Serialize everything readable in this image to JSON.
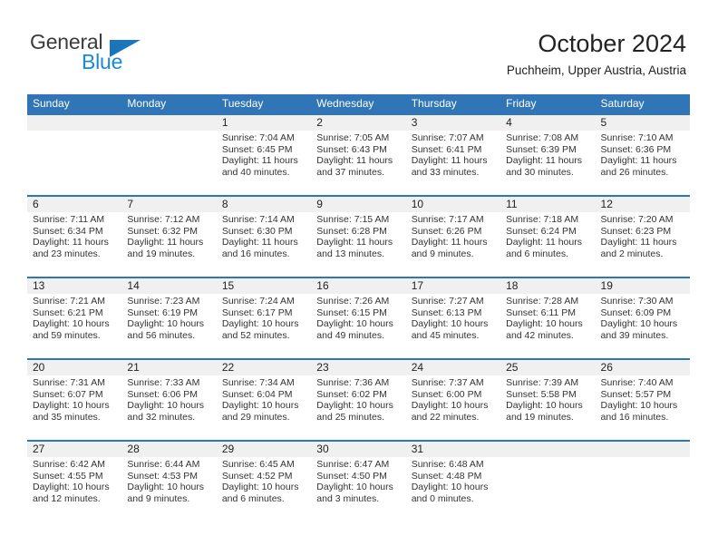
{
  "brand": {
    "name_part1": "General",
    "name_part2": "Blue",
    "triangle_color": "#1b75bb",
    "blue_color": "#1b8ad6"
  },
  "header": {
    "title": "October 2024",
    "subtitle": "Puchheim, Upper Austria, Austria"
  },
  "theme": {
    "header_blue": "#3075b5",
    "daynum_band": "#f0f0f0",
    "text": "#222222"
  },
  "labels": {
    "sunrise_prefix": "Sunrise: ",
    "sunset_prefix": "Sunset: ",
    "daylight_prefix": "Daylight: "
  },
  "weekdays": [
    "Sunday",
    "Monday",
    "Tuesday",
    "Wednesday",
    "Thursday",
    "Friday",
    "Saturday"
  ],
  "weeks": [
    [
      {
        "day": "",
        "sunrise": "",
        "sunset": "",
        "daylight": "",
        "empty": true
      },
      {
        "day": "",
        "sunrise": "",
        "sunset": "",
        "daylight": "",
        "empty": true
      },
      {
        "day": "1",
        "sunrise": "Sunrise: 7:04 AM",
        "sunset": "Sunset: 6:45 PM",
        "daylight": "Daylight: 11 hours and 40 minutes."
      },
      {
        "day": "2",
        "sunrise": "Sunrise: 7:05 AM",
        "sunset": "Sunset: 6:43 PM",
        "daylight": "Daylight: 11 hours and 37 minutes."
      },
      {
        "day": "3",
        "sunrise": "Sunrise: 7:07 AM",
        "sunset": "Sunset: 6:41 PM",
        "daylight": "Daylight: 11 hours and 33 minutes."
      },
      {
        "day": "4",
        "sunrise": "Sunrise: 7:08 AM",
        "sunset": "Sunset: 6:39 PM",
        "daylight": "Daylight: 11 hours and 30 minutes."
      },
      {
        "day": "5",
        "sunrise": "Sunrise: 7:10 AM",
        "sunset": "Sunset: 6:36 PM",
        "daylight": "Daylight: 11 hours and 26 minutes."
      }
    ],
    [
      {
        "day": "6",
        "sunrise": "Sunrise: 7:11 AM",
        "sunset": "Sunset: 6:34 PM",
        "daylight": "Daylight: 11 hours and 23 minutes."
      },
      {
        "day": "7",
        "sunrise": "Sunrise: 7:12 AM",
        "sunset": "Sunset: 6:32 PM",
        "daylight": "Daylight: 11 hours and 19 minutes."
      },
      {
        "day": "8",
        "sunrise": "Sunrise: 7:14 AM",
        "sunset": "Sunset: 6:30 PM",
        "daylight": "Daylight: 11 hours and 16 minutes."
      },
      {
        "day": "9",
        "sunrise": "Sunrise: 7:15 AM",
        "sunset": "Sunset: 6:28 PM",
        "daylight": "Daylight: 11 hours and 13 minutes."
      },
      {
        "day": "10",
        "sunrise": "Sunrise: 7:17 AM",
        "sunset": "Sunset: 6:26 PM",
        "daylight": "Daylight: 11 hours and 9 minutes."
      },
      {
        "day": "11",
        "sunrise": "Sunrise: 7:18 AM",
        "sunset": "Sunset: 6:24 PM",
        "daylight": "Daylight: 11 hours and 6 minutes."
      },
      {
        "day": "12",
        "sunrise": "Sunrise: 7:20 AM",
        "sunset": "Sunset: 6:23 PM",
        "daylight": "Daylight: 11 hours and 2 minutes."
      }
    ],
    [
      {
        "day": "13",
        "sunrise": "Sunrise: 7:21 AM",
        "sunset": "Sunset: 6:21 PM",
        "daylight": "Daylight: 10 hours and 59 minutes."
      },
      {
        "day": "14",
        "sunrise": "Sunrise: 7:23 AM",
        "sunset": "Sunset: 6:19 PM",
        "daylight": "Daylight: 10 hours and 56 minutes."
      },
      {
        "day": "15",
        "sunrise": "Sunrise: 7:24 AM",
        "sunset": "Sunset: 6:17 PM",
        "daylight": "Daylight: 10 hours and 52 minutes."
      },
      {
        "day": "16",
        "sunrise": "Sunrise: 7:26 AM",
        "sunset": "Sunset: 6:15 PM",
        "daylight": "Daylight: 10 hours and 49 minutes."
      },
      {
        "day": "17",
        "sunrise": "Sunrise: 7:27 AM",
        "sunset": "Sunset: 6:13 PM",
        "daylight": "Daylight: 10 hours and 45 minutes."
      },
      {
        "day": "18",
        "sunrise": "Sunrise: 7:28 AM",
        "sunset": "Sunset: 6:11 PM",
        "daylight": "Daylight: 10 hours and 42 minutes."
      },
      {
        "day": "19",
        "sunrise": "Sunrise: 7:30 AM",
        "sunset": "Sunset: 6:09 PM",
        "daylight": "Daylight: 10 hours and 39 minutes."
      }
    ],
    [
      {
        "day": "20",
        "sunrise": "Sunrise: 7:31 AM",
        "sunset": "Sunset: 6:07 PM",
        "daylight": "Daylight: 10 hours and 35 minutes."
      },
      {
        "day": "21",
        "sunrise": "Sunrise: 7:33 AM",
        "sunset": "Sunset: 6:06 PM",
        "daylight": "Daylight: 10 hours and 32 minutes."
      },
      {
        "day": "22",
        "sunrise": "Sunrise: 7:34 AM",
        "sunset": "Sunset: 6:04 PM",
        "daylight": "Daylight: 10 hours and 29 minutes."
      },
      {
        "day": "23",
        "sunrise": "Sunrise: 7:36 AM",
        "sunset": "Sunset: 6:02 PM",
        "daylight": "Daylight: 10 hours and 25 minutes."
      },
      {
        "day": "24",
        "sunrise": "Sunrise: 7:37 AM",
        "sunset": "Sunset: 6:00 PM",
        "daylight": "Daylight: 10 hours and 22 minutes."
      },
      {
        "day": "25",
        "sunrise": "Sunrise: 7:39 AM",
        "sunset": "Sunset: 5:58 PM",
        "daylight": "Daylight: 10 hours and 19 minutes."
      },
      {
        "day": "26",
        "sunrise": "Sunrise: 7:40 AM",
        "sunset": "Sunset: 5:57 PM",
        "daylight": "Daylight: 10 hours and 16 minutes."
      }
    ],
    [
      {
        "day": "27",
        "sunrise": "Sunrise: 6:42 AM",
        "sunset": "Sunset: 4:55 PM",
        "daylight": "Daylight: 10 hours and 12 minutes."
      },
      {
        "day": "28",
        "sunrise": "Sunrise: 6:44 AM",
        "sunset": "Sunset: 4:53 PM",
        "daylight": "Daylight: 10 hours and 9 minutes."
      },
      {
        "day": "29",
        "sunrise": "Sunrise: 6:45 AM",
        "sunset": "Sunset: 4:52 PM",
        "daylight": "Daylight: 10 hours and 6 minutes."
      },
      {
        "day": "30",
        "sunrise": "Sunrise: 6:47 AM",
        "sunset": "Sunset: 4:50 PM",
        "daylight": "Daylight: 10 hours and 3 minutes."
      },
      {
        "day": "31",
        "sunrise": "Sunrise: 6:48 AM",
        "sunset": "Sunset: 4:48 PM",
        "daylight": "Daylight: 10 hours and 0 minutes."
      },
      {
        "day": "",
        "sunrise": "",
        "sunset": "",
        "daylight": "",
        "empty": true
      },
      {
        "day": "",
        "sunrise": "",
        "sunset": "",
        "daylight": "",
        "empty": true
      }
    ]
  ]
}
